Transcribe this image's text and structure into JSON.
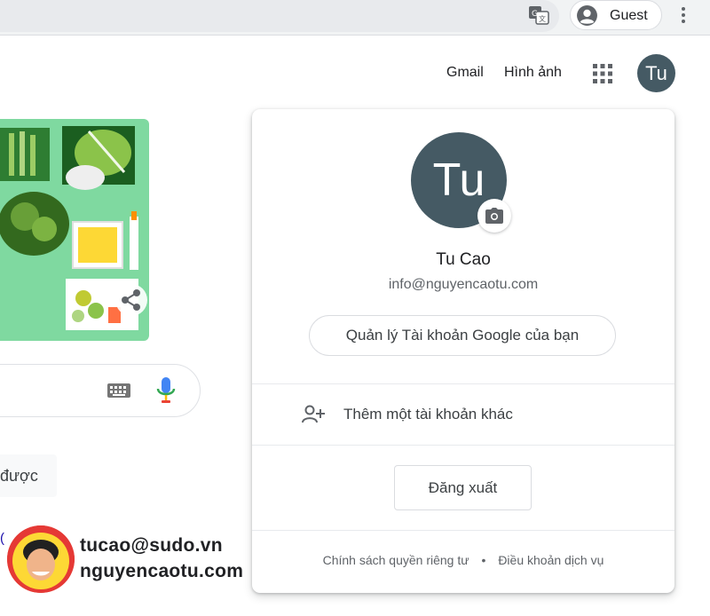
{
  "browser": {
    "profile_label": "Guest"
  },
  "header": {
    "links": [
      "Gmail",
      "Hình ảnh"
    ],
    "avatar_initials": "Tu"
  },
  "search": {
    "lucky_button_label_partial": "được"
  },
  "stray_text": "(",
  "watermark": {
    "email": "tucao@sudo.vn",
    "site": "nguyencaotu.com"
  },
  "account_popover": {
    "avatar_initials": "Tu",
    "name": "Tu Cao",
    "email": "info@nguyencaotu.com",
    "manage_label": "Quản lý Tài khoản Google của bạn",
    "add_account_label": "Thêm một tài khoản khác",
    "sign_out_label": "Đăng xuất",
    "privacy_label": "Chính sách quyền riêng tư",
    "terms_label": "Điều khoản dịch vụ"
  },
  "colors": {
    "avatar_bg": "#455a64",
    "doodle_bg": "#7fd9a0",
    "toolbar_bg": "#f1f3f4",
    "text_secondary": "#5f6368"
  },
  "icons": [
    "translate-icon",
    "guest-avatar-icon",
    "kebab-menu-icon",
    "apps-grid-icon",
    "share-icon",
    "keyboard-icon",
    "mic-icon",
    "camera-icon",
    "add-person-icon"
  ]
}
